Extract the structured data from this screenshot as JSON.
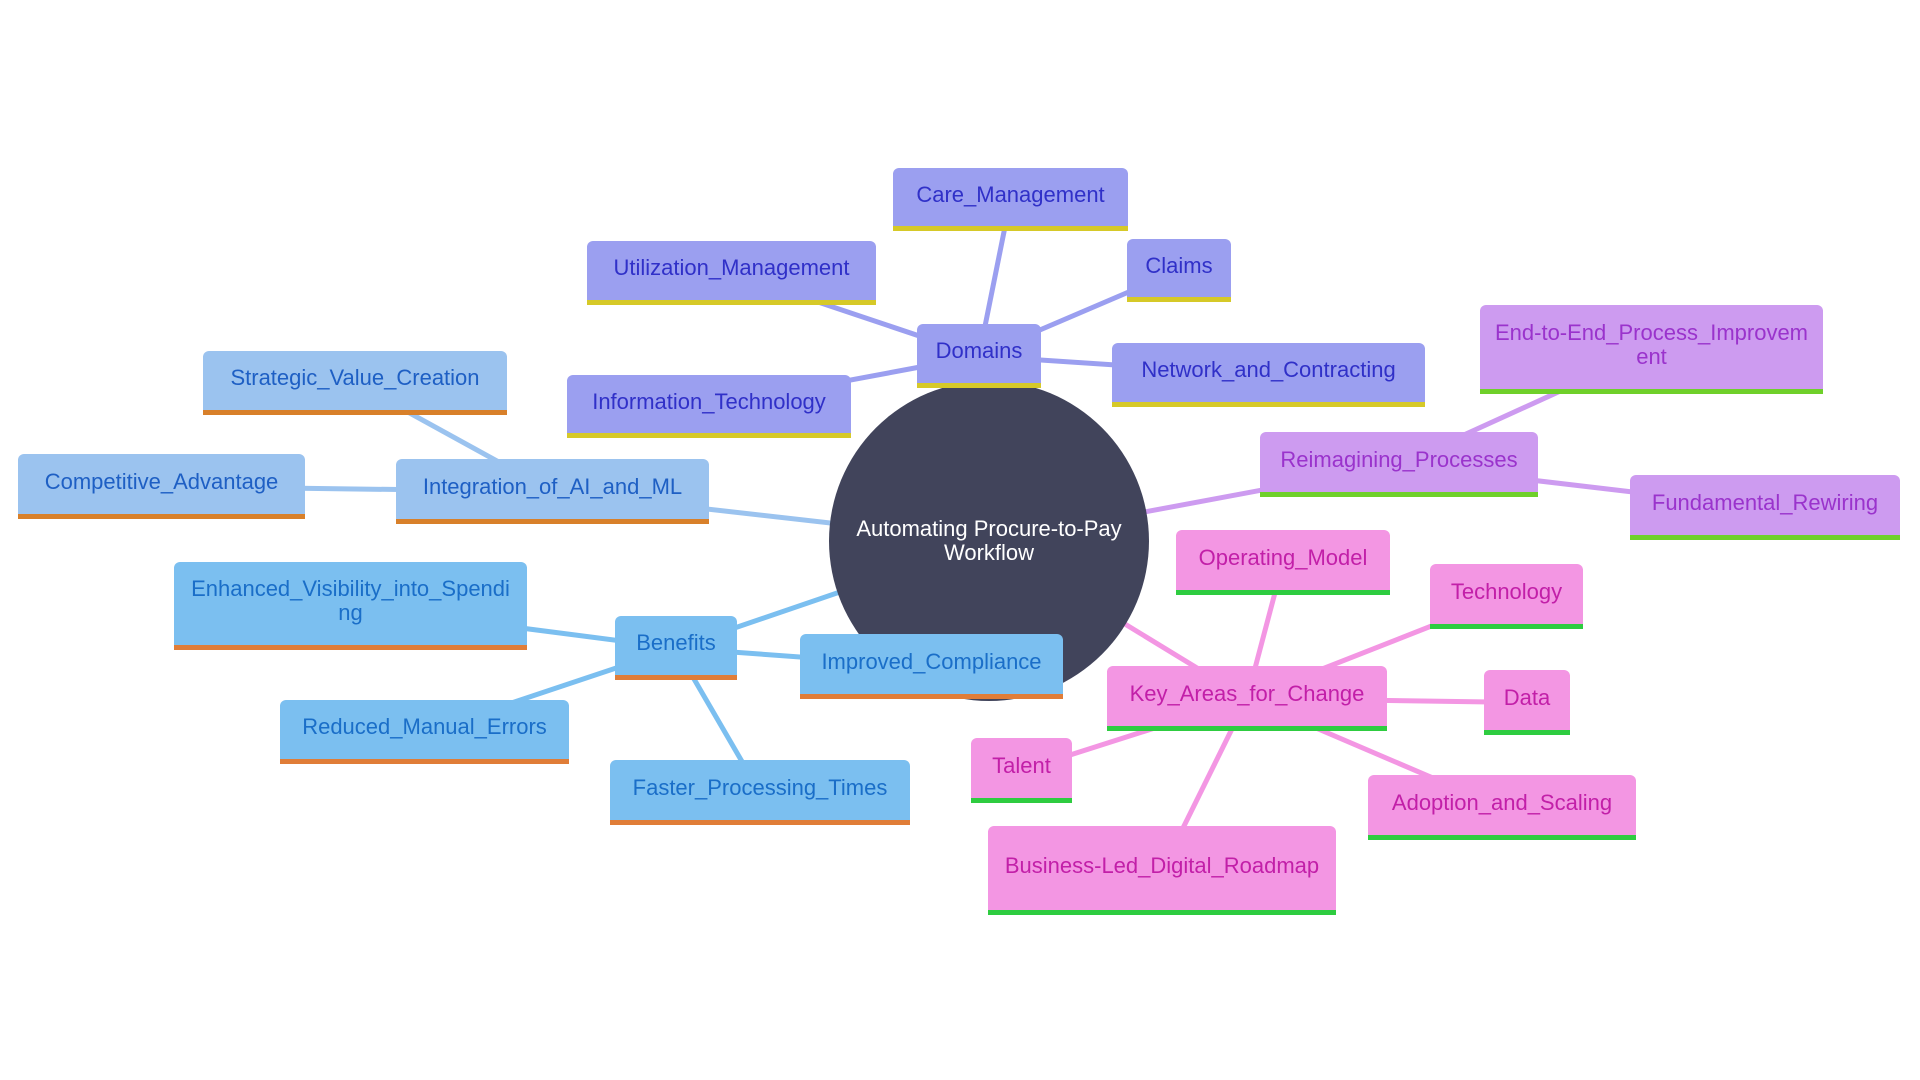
{
  "title": "Automating Procure-to-Pay Workflow mind map",
  "colors": {
    "root_fill": "#41445b",
    "root_text": "#ffffff"
  },
  "root": {
    "id": "root",
    "label": "Automating Procure-to-Pay Workflow"
  },
  "branches": [
    {
      "id": "domains",
      "label": "Domains",
      "colors": {
        "fill": "#9b9ff0",
        "text": "#3030c8",
        "border": "#d6c928",
        "edge": "#9b9ff0"
      },
      "children": [
        {
          "id": "care-management",
          "label": "Care_Management"
        },
        {
          "id": "utilization-management",
          "label": "Utilization_Management"
        },
        {
          "id": "claims",
          "label": "Claims"
        },
        {
          "id": "network-and-contracting",
          "label": "Network_and_Contracting"
        },
        {
          "id": "information-technology",
          "label": "Information_Technology"
        }
      ]
    },
    {
      "id": "integration-of-ai-and-ml",
      "label": "Integration_of_AI_and_ML",
      "colors": {
        "fill": "#9bc3ef",
        "text": "#1e5fc4",
        "border": "#d8802a",
        "edge": "#9bc3ef"
      },
      "children": [
        {
          "id": "strategic-value-creation",
          "label": "Strategic_Value_Creation"
        },
        {
          "id": "competitive-advantage",
          "label": "Competitive_Advantage"
        }
      ]
    },
    {
      "id": "benefits",
      "label": "Benefits",
      "colors": {
        "fill": "#7bbff0",
        "text": "#1a6ec8",
        "border": "#e07d38",
        "edge": "#7bbff0"
      },
      "children": [
        {
          "id": "enhanced-visibility-into-spending",
          "label": "Enhanced_Visibility_into_Spending"
        },
        {
          "id": "improved-compliance",
          "label": "Improved_Compliance"
        },
        {
          "id": "reduced-manual-errors",
          "label": "Reduced_Manual_Errors"
        },
        {
          "id": "faster-processing-times",
          "label": "Faster_Processing_Times"
        }
      ]
    },
    {
      "id": "reimagining-processes",
      "label": "Reimagining_Processes",
      "colors": {
        "fill": "#cd9bf0",
        "text": "#9a33cc",
        "border": "#6fd02a",
        "edge": "#cd9bf0"
      },
      "children": [
        {
          "id": "end-to-end-process-improvement",
          "label": "End-to-End_Process_Improvement"
        },
        {
          "id": "fundamental-rewiring",
          "label": "Fundamental_Rewiring"
        }
      ]
    },
    {
      "id": "key-areas-for-change",
      "label": "Key_Areas_for_Change",
      "colors": {
        "fill": "#f396e3",
        "text": "#c21fa8",
        "border": "#2ecc40",
        "edge": "#f396e3"
      },
      "children": [
        {
          "id": "operating-model",
          "label": "Operating_Model"
        },
        {
          "id": "technology",
          "label": "Technology"
        },
        {
          "id": "data",
          "label": "Data"
        },
        {
          "id": "talent",
          "label": "Talent"
        },
        {
          "id": "adoption-and-scaling",
          "label": "Adoption_and_Scaling"
        },
        {
          "id": "business-led-digital-roadmap",
          "label": "Business-Led_Digital_Roadmap"
        }
      ]
    }
  ]
}
